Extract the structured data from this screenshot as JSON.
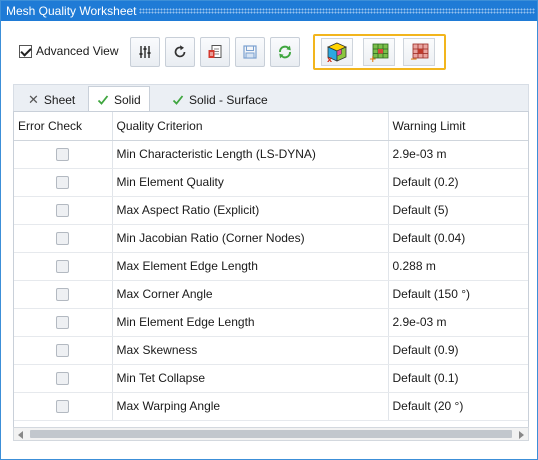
{
  "window": {
    "title": "Mesh Quality Worksheet"
  },
  "toolbar": {
    "advanced_view_label": "Advanced View",
    "advanced_view_checked": true,
    "buttons": [
      {
        "icon": "sliders-icon"
      },
      {
        "icon": "refresh-icon"
      },
      {
        "icon": "export-document-icon"
      },
      {
        "icon": "save-icon"
      },
      {
        "icon": "update-icon"
      }
    ],
    "highlight_color": "#f2b51d",
    "highlighted_buttons": [
      {
        "icon": "mesh-cube-remove-icon"
      },
      {
        "icon": "mesh-add-icon"
      },
      {
        "icon": "mesh-remove-icon"
      }
    ]
  },
  "tabs": [
    {
      "label": "Sheet",
      "icon": "close-icon",
      "active": false
    },
    {
      "label": "Solid",
      "icon": "checkmark-icon",
      "active": true
    },
    {
      "label": "Solid - Surface",
      "icon": "checkmark-icon",
      "active": false
    }
  ],
  "table": {
    "columns": [
      "Error Check",
      "Quality Criterion",
      "Warning Limit"
    ],
    "rows": [
      {
        "error_check": false,
        "criterion": "Min Characteristic Length (LS-DYNA)",
        "warning_limit": "2.9e-03 m"
      },
      {
        "error_check": false,
        "criterion": "Min Element Quality",
        "warning_limit": "Default (0.2)"
      },
      {
        "error_check": false,
        "criterion": "Max Aspect Ratio (Explicit)",
        "warning_limit": "Default (5)"
      },
      {
        "error_check": false,
        "criterion": "Min Jacobian Ratio (Corner Nodes)",
        "warning_limit": "Default (0.04)"
      },
      {
        "error_check": false,
        "criterion": "Max Element Edge Length",
        "warning_limit": "0.288 m"
      },
      {
        "error_check": false,
        "criterion": "Max Corner Angle",
        "warning_limit": "Default (150 °)"
      },
      {
        "error_check": false,
        "criterion": "Min Element Edge Length",
        "warning_limit": "2.9e-03 m"
      },
      {
        "error_check": false,
        "criterion": "Max Skewness",
        "warning_limit": "Default (0.9)"
      },
      {
        "error_check": false,
        "criterion": "Min Tet Collapse",
        "warning_limit": "Default (0.1)"
      },
      {
        "error_check": false,
        "criterion": "Max Warping Angle",
        "warning_limit": "Default (20 °)"
      }
    ]
  },
  "colors": {
    "titlebar": "#1f7bd6",
    "accent_green": "#3fa63f"
  }
}
